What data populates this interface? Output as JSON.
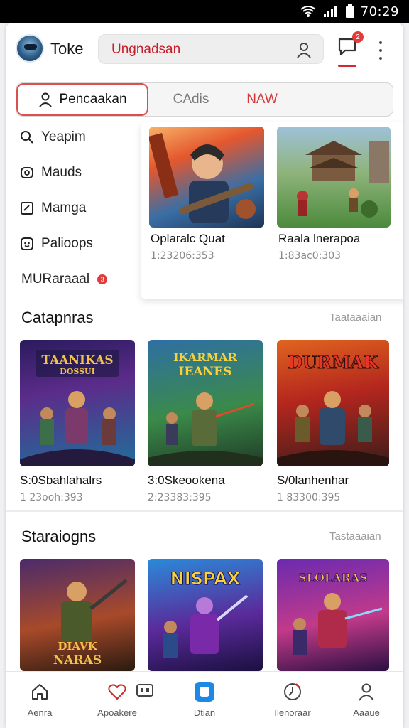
{
  "status_bar": {
    "time": "70:29"
  },
  "header": {
    "brand": "Toke",
    "search_text": "Ungnadsan",
    "notification_count": "2",
    "colors": {
      "accent": "#d62630"
    }
  },
  "tabs": [
    {
      "label": "Pencaakan",
      "icon": "user-icon"
    },
    {
      "label": "CAdis"
    },
    {
      "label": "NAW"
    }
  ],
  "sidebar": {
    "items": [
      {
        "label": "Yeapim",
        "icon": "search-icon"
      },
      {
        "label": "Mauds",
        "icon": "camera-icon"
      },
      {
        "label": "Mamga",
        "icon": "bookmark-icon"
      },
      {
        "label": "Palioops",
        "icon": "chat-icon"
      },
      {
        "label": "MURaraaal",
        "icon": "",
        "badge": "3"
      }
    ]
  },
  "popup_cards": [
    {
      "title": "Oplaralc Quat",
      "sub": "1:23206:353"
    },
    {
      "title": "Raala lnerapoa",
      "sub": "1:83ac0:303"
    }
  ],
  "section1": {
    "title": "Catapnras",
    "link": "Taataaaian",
    "cards": [
      {
        "art": "TAANIKAS DOSSUI",
        "title": "S:0Sbahlahalrs",
        "sub": "1 23ooh:393"
      },
      {
        "art": "IKARMAR IEANES",
        "title": "3:0Skeookena",
        "sub": "2:23383:395"
      },
      {
        "art": "DURMAK",
        "title": "S/0lanhenhar",
        "sub": "1 83300:395"
      }
    ]
  },
  "section2": {
    "title": "Staraiogns",
    "link": "Tastaaaian",
    "cards": [
      {
        "art": "DIAVK NARAS"
      },
      {
        "art": "NISPAX"
      },
      {
        "art": "SLOLARAS"
      }
    ]
  },
  "bottom_nav": [
    {
      "label": "Aenra",
      "icon": "home-icon"
    },
    {
      "label": "Apoakere",
      "icon": "heart-icon"
    },
    {
      "label": "Dtian",
      "icon": "gamepad-icon",
      "active": true
    },
    {
      "label": "Ilenoraar",
      "icon": "clock-icon"
    },
    {
      "label": "Aaaue",
      "icon": "profile-icon"
    }
  ]
}
